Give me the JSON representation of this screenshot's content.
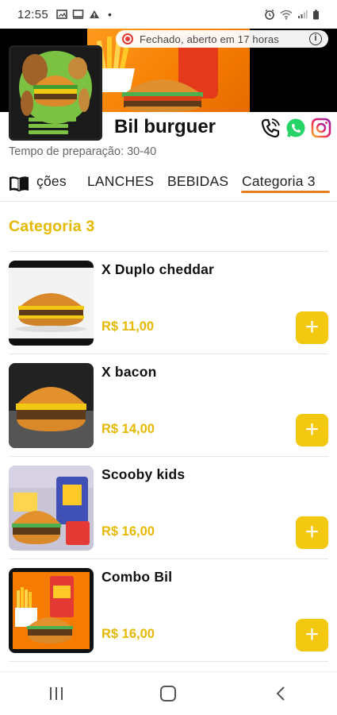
{
  "status_bar": {
    "time": "12:55",
    "dot": "•",
    "left_icons": [
      "photo-icon",
      "cast-icon",
      "warning-icon"
    ],
    "right_icons": [
      "alarm-icon",
      "wifi-icon",
      "signal-icon",
      "battery-icon"
    ]
  },
  "banner": {
    "status_text": "Fechado, aberto em 17 horas",
    "info_icon": "info-icon"
  },
  "store": {
    "name": "Bil burguer",
    "prep_time": "Tempo de preparação: 30-40",
    "social_icons": [
      "phone-icon",
      "whatsapp-icon",
      "instagram-icon"
    ]
  },
  "tabs": {
    "menu_icon": "menu-book-icon",
    "items": [
      {
        "label": "ções"
      },
      {
        "label": "LANCHES"
      },
      {
        "label": "BEBIDAS"
      },
      {
        "label": "Categoria 3"
      }
    ],
    "active_index": 3
  },
  "section": {
    "title": "Categoria 3"
  },
  "products": [
    {
      "name": "X Duplo cheddar",
      "price": "R$ 11,00",
      "add_label": "+"
    },
    {
      "name": "X bacon",
      "price": "R$ 14,00",
      "add_label": "+"
    },
    {
      "name": "Scooby kids",
      "price": "R$ 16,00",
      "add_label": "+"
    },
    {
      "name": "Combo Bil",
      "price": "R$ 16,00",
      "add_label": "+"
    }
  ],
  "nav": {
    "items": [
      "recents-icon",
      "home-icon",
      "back-icon"
    ]
  },
  "colors": {
    "accent_yellow": "#e6b800",
    "add_button": "#f2c811",
    "tab_underline": "#e67e22",
    "closed_red": "#e53935",
    "banner_orange": "#f57c00"
  }
}
